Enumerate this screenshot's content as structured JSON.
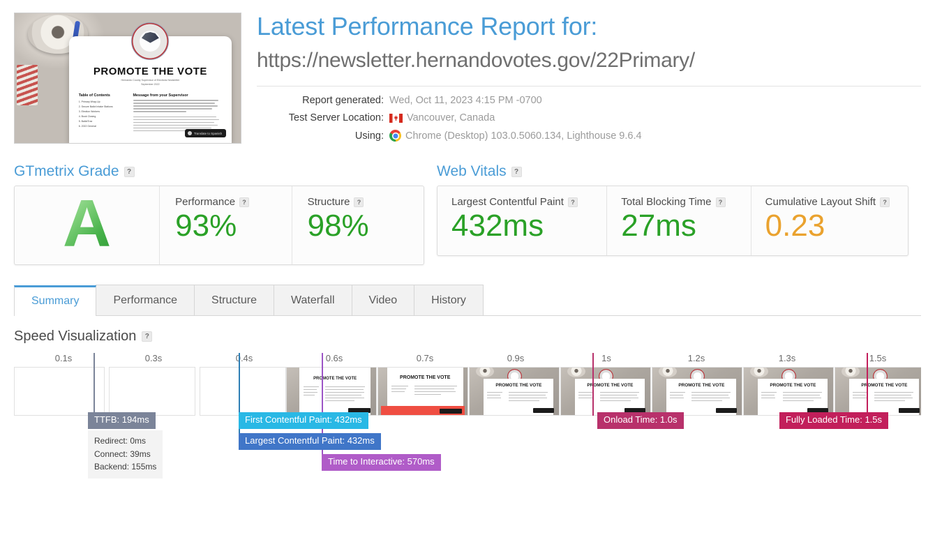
{
  "header": {
    "title": "Latest Performance Report for:",
    "url": "https://newsletter.hernandovotes.gov/22Primary/",
    "meta": [
      {
        "label": "Report generated:",
        "value": "Wed, Oct 11, 2023 4:15 PM -0700",
        "icon": ""
      },
      {
        "label": "Test Server Location:",
        "value": "Vancouver, Canada",
        "icon": "canada-flag-icon"
      },
      {
        "label": "Using:",
        "value": "Chrome (Desktop) 103.0.5060.134, Lighthouse 9.6.4",
        "icon": "chrome-icon"
      }
    ],
    "thumbnail": {
      "doc_title": "PROMOTE THE VOTE",
      "doc_subtitle": "Hernando County Supervisor of Elections Newsletter\nSeptember 2022",
      "toc_heading": "Table of Contents",
      "toc_items": [
        "1. Primary Wrap-Up",
        "2. Secure Ballot Intake Stations",
        "3. Election Workers",
        "4. Book Closing",
        "5. BallotTrax",
        "6. 2022 General"
      ],
      "message_heading": "Message from your Supervisor",
      "translate_label": "Translate to Spanish"
    }
  },
  "gtmetrix_grade": {
    "section_title": "GTmetrix Grade",
    "help": "?",
    "grade": "A",
    "metrics": [
      {
        "label": "Performance",
        "value": "93%",
        "color": "#2aa127",
        "help": "?"
      },
      {
        "label": "Structure",
        "value": "98%",
        "color": "#2aa127",
        "help": "?"
      }
    ]
  },
  "web_vitals": {
    "section_title": "Web Vitals",
    "help": "?",
    "metrics": [
      {
        "label": "Largest Contentful Paint",
        "value": "432ms",
        "color": "#2aa127",
        "help": "?"
      },
      {
        "label": "Total Blocking Time",
        "value": "27ms",
        "color": "#2aa127",
        "help": "?"
      },
      {
        "label": "Cumulative Layout Shift",
        "value": "0.23",
        "color": "#eaa22e",
        "help": "?"
      }
    ]
  },
  "tabs": [
    {
      "label": "Summary",
      "active": true
    },
    {
      "label": "Performance",
      "active": false
    },
    {
      "label": "Structure",
      "active": false
    },
    {
      "label": "Waterfall",
      "active": false
    },
    {
      "label": "Video",
      "active": false
    },
    {
      "label": "History",
      "active": false
    }
  ],
  "speed_visualization": {
    "section_title": "Speed Visualization",
    "help": "?",
    "tick_labels": [
      "0.1s",
      "0.3s",
      "0.4s",
      "0.6s",
      "0.7s",
      "0.9s",
      "1s",
      "1.2s",
      "1.3s",
      "1.5s"
    ],
    "markers": [
      {
        "name": "ttfb",
        "label": "TTFB: 194ms",
        "bg": "#7b8499",
        "line": "#7b8499"
      },
      {
        "name": "first-contentful-paint",
        "label": "First Contentful Paint: 432ms",
        "bg": "#29b8e5",
        "line": "#2f7fb5"
      },
      {
        "name": "largest-contentful-paint",
        "label": "Largest Contentful Paint: 432ms",
        "bg": "#4076c8",
        "line": "#2f7fb5"
      },
      {
        "name": "time-to-interactive",
        "label": "Time to Interactive: 570ms",
        "bg": "#b05cc8",
        "line": "#9c55c6"
      },
      {
        "name": "onload-time",
        "label": "Onload Time: 1.0s",
        "bg": "#b8316b",
        "line": "#b8316b"
      },
      {
        "name": "fully-loaded-time",
        "label": "Fully Loaded Time: 1.5s",
        "bg": "#c21f5b",
        "line": "#c21f5b"
      }
    ],
    "ttfb_breakdown": [
      "Redirect: 0ms",
      "Connect: 39ms",
      "Backend: 155ms"
    ]
  },
  "colors": {
    "accent_blue": "#4a9cd6",
    "good_green": "#2aa127",
    "warn_amber": "#eaa22e",
    "text_gray": "#6f6f6f"
  }
}
